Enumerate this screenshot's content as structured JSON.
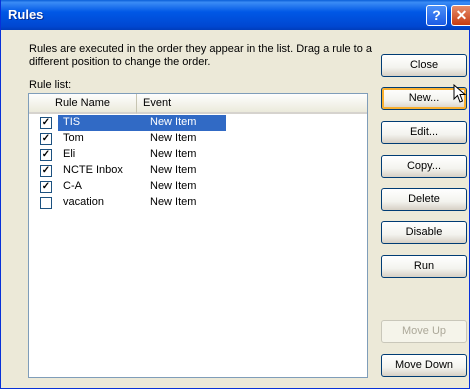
{
  "window": {
    "title": "Rules",
    "help_glyph": "?",
    "close_glyph": "✕"
  },
  "description": "Rules are executed in the order they appear in the list.  Drag a rule to a different position to change the order.",
  "rule_list_label": "Rule list:",
  "columns": {
    "name": "Rule Name",
    "event": "Event"
  },
  "rules": [
    {
      "name": "TIS",
      "event": "New Item",
      "checked": true,
      "selected": true
    },
    {
      "name": "Tom",
      "event": "New Item",
      "checked": true,
      "selected": false
    },
    {
      "name": "Eli",
      "event": "New Item",
      "checked": true,
      "selected": false
    },
    {
      "name": "NCTE Inbox",
      "event": "New Item",
      "checked": true,
      "selected": false
    },
    {
      "name": "C-A",
      "event": "New Item",
      "checked": true,
      "selected": false
    },
    {
      "name": "vacation",
      "event": "New Item",
      "checked": false,
      "selected": false
    }
  ],
  "buttons": {
    "close": "Close",
    "new": "New...",
    "edit": "Edit...",
    "copy": "Copy...",
    "delete": "Delete",
    "disable": "Disable",
    "run": "Run",
    "move_up": "Move Up",
    "move_down": "Move Down"
  },
  "colors": {
    "selection": "#316ac5",
    "titlebar": "#0058e6",
    "dialog_bg": "#ece9d8"
  }
}
